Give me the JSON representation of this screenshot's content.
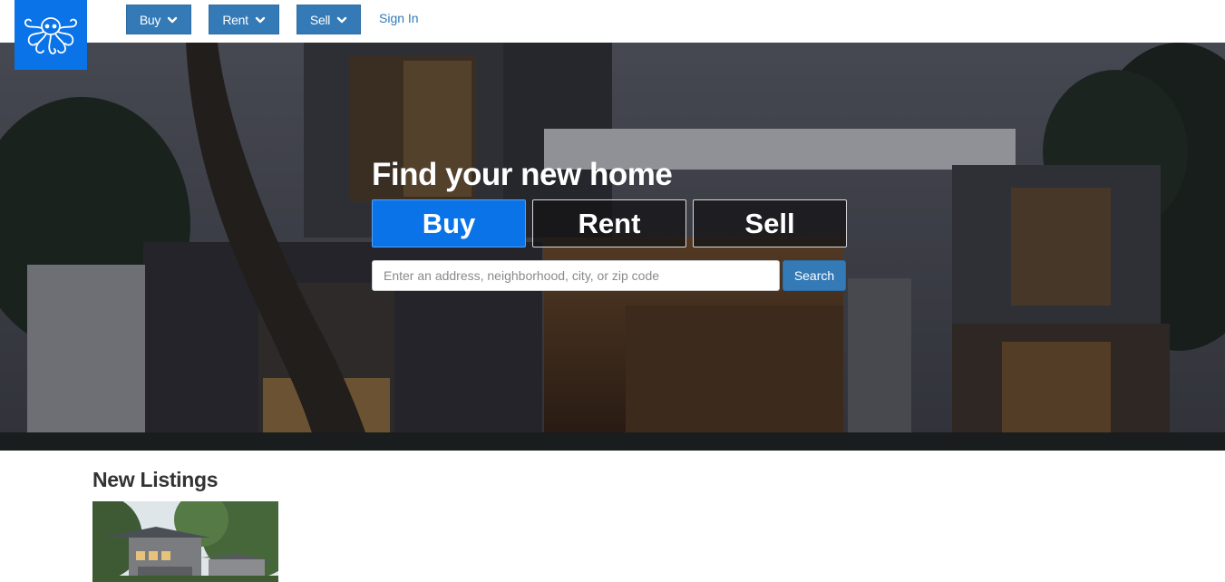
{
  "header": {
    "logo": "octopus-logo",
    "nav": [
      {
        "label": "Buy"
      },
      {
        "label": "Rent"
      },
      {
        "label": "Sell"
      }
    ],
    "signin_label": "Sign In"
  },
  "hero": {
    "title": "Find your new home",
    "tabs": [
      {
        "label": "Buy",
        "active": true
      },
      {
        "label": "Rent",
        "active": false
      },
      {
        "label": "Sell",
        "active": false
      }
    ],
    "search": {
      "placeholder": "Enter an address, neighborhood, city, or zip code",
      "value": "",
      "button_label": "Search"
    }
  },
  "listings": {
    "title": "New Listings"
  },
  "colors": {
    "brand": "#0a73e8",
    "button": "#337ab7"
  }
}
